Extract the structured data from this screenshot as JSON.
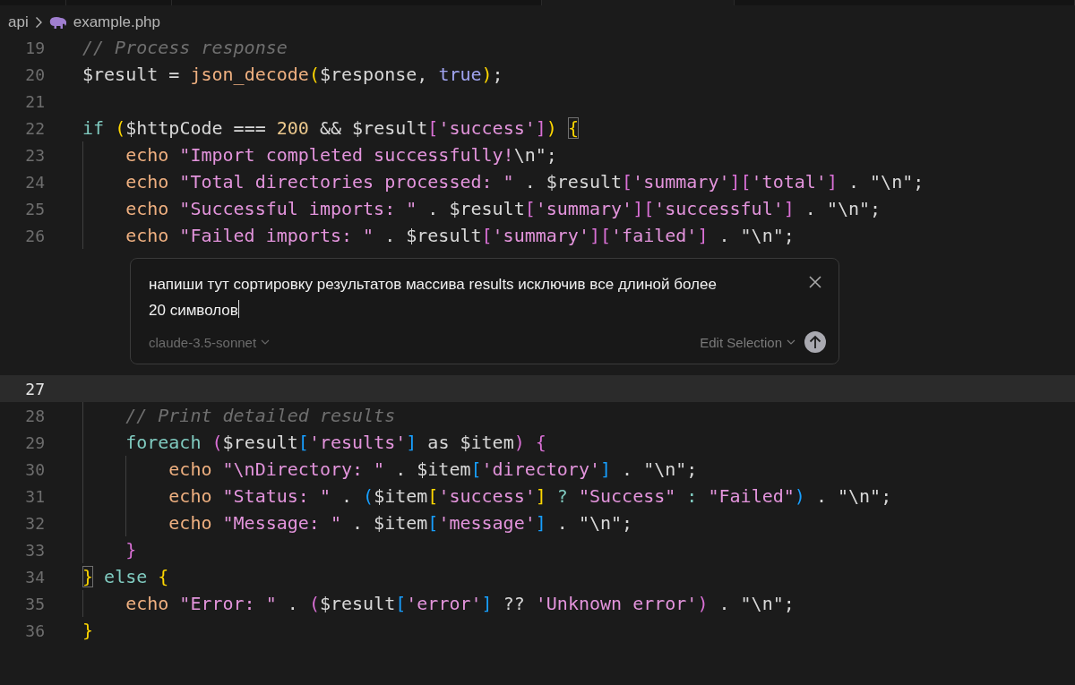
{
  "breadcrumb": {
    "folder": "api",
    "file": "example.php"
  },
  "code_top": [
    {
      "number": "19",
      "current": false,
      "tokens": [
        {
          "kind": "c",
          "text": "// Process response"
        }
      ]
    },
    {
      "number": "20",
      "current": false,
      "tokens": [
        {
          "kind": "t",
          "text": "$result = "
        },
        {
          "kind": "f",
          "text": "json_decode"
        },
        {
          "kind": "g",
          "text": "("
        },
        {
          "kind": "t",
          "text": "$response, "
        },
        {
          "kind": "b",
          "text": "true"
        },
        {
          "kind": "g",
          "text": ")"
        },
        {
          "kind": "t",
          "text": ";"
        }
      ]
    },
    {
      "number": "21",
      "current": false
    },
    {
      "number": "22",
      "current": false,
      "tokens": [
        {
          "kind": "k",
          "text": "if"
        },
        {
          "kind": "g",
          "text": " ("
        },
        {
          "kind": "t",
          "text": "$httpCode === "
        },
        {
          "kind": "n",
          "text": "200"
        },
        {
          "kind": "t",
          "text": " && $result"
        },
        {
          "kind": "p",
          "text": "["
        },
        {
          "kind": "s",
          "text": "'success'"
        },
        {
          "kind": "p",
          "text": "]"
        },
        {
          "kind": "g",
          "text": ") "
        },
        {
          "kind": "gm",
          "text": "{"
        }
      ]
    },
    {
      "number": "23",
      "current": false,
      "tokens": [
        {
          "kind": "f",
          "text": "    echo"
        },
        {
          "kind": "s",
          "text": " \"Import completed successfully!"
        },
        {
          "kind": "t",
          "text": "\\n\";"
        }
      ]
    },
    {
      "number": "24",
      "current": false,
      "tokens": [
        {
          "kind": "f",
          "text": "    echo"
        },
        {
          "kind": "s",
          "text": " \"Total directories processed: \""
        },
        {
          "kind": "t",
          "text": " . $result"
        },
        {
          "kind": "p",
          "text": "["
        },
        {
          "kind": "s",
          "text": "'summary'"
        },
        {
          "kind": "p",
          "text": "]["
        },
        {
          "kind": "s",
          "text": "'total'"
        },
        {
          "kind": "p",
          "text": "]"
        },
        {
          "kind": "t",
          "text": " . \"\\n\";"
        }
      ]
    },
    {
      "number": "25",
      "current": false,
      "tokens": [
        {
          "kind": "f",
          "text": "    echo"
        },
        {
          "kind": "s",
          "text": " \"Successful imports: \""
        },
        {
          "kind": "t",
          "text": " . $result"
        },
        {
          "kind": "p",
          "text": "["
        },
        {
          "kind": "s",
          "text": "'summary'"
        },
        {
          "kind": "p",
          "text": "]["
        },
        {
          "kind": "s",
          "text": "'successful'"
        },
        {
          "kind": "p",
          "text": "]"
        },
        {
          "kind": "t",
          "text": " . \"\\n\";"
        }
      ]
    },
    {
      "number": "26",
      "current": false,
      "tokens": [
        {
          "kind": "f",
          "text": "    echo"
        },
        {
          "kind": "s",
          "text": " \"Failed imports: \""
        },
        {
          "kind": "t",
          "text": " . $result"
        },
        {
          "kind": "p",
          "text": "["
        },
        {
          "kind": "s",
          "text": "'summary'"
        },
        {
          "kind": "p",
          "text": "]["
        },
        {
          "kind": "s",
          "text": "'failed'"
        },
        {
          "kind": "p",
          "text": "]"
        },
        {
          "kind": "t",
          "text": " . \"\\n\";"
        }
      ]
    }
  ],
  "prompt": {
    "value": "напиши тут сортировку результатов массива results исключив все длиной более 20 символов",
    "model": "claude-3.5-sonnet",
    "mode": "Edit Selection"
  },
  "code_bottom": [
    {
      "number": "27",
      "current": true
    },
    {
      "number": "28",
      "current": false,
      "tokens": [
        {
          "kind": "c",
          "text": "    // Print detailed results"
        }
      ]
    },
    {
      "number": "29",
      "current": false,
      "tokens": [
        {
          "kind": "k",
          "text": "    foreach"
        },
        {
          "kind": "p",
          "text": " ("
        },
        {
          "kind": "t",
          "text": "$result"
        },
        {
          "kind": "u",
          "text": "["
        },
        {
          "kind": "s",
          "text": "'results'"
        },
        {
          "kind": "u",
          "text": "]"
        },
        {
          "kind": "t",
          "text": " as $item"
        },
        {
          "kind": "p",
          "text": ")"
        },
        {
          "kind": "p",
          "text": " {"
        }
      ]
    },
    {
      "number": "30",
      "current": false,
      "tokens": [
        {
          "kind": "f",
          "text": "        echo"
        },
        {
          "kind": "s",
          "text": " \"\\nDirectory: \""
        },
        {
          "kind": "t",
          "text": " . $item"
        },
        {
          "kind": "u",
          "text": "["
        },
        {
          "kind": "s",
          "text": "'directory'"
        },
        {
          "kind": "u",
          "text": "]"
        },
        {
          "kind": "t",
          "text": " . \"\\n\";"
        }
      ]
    },
    {
      "number": "31",
      "current": false,
      "tokens": [
        {
          "kind": "f",
          "text": "        echo"
        },
        {
          "kind": "s",
          "text": " \"Status: \""
        },
        {
          "kind": "t",
          "text": " . "
        },
        {
          "kind": "u",
          "text": "("
        },
        {
          "kind": "t",
          "text": "$item"
        },
        {
          "kind": "g",
          "text": "["
        },
        {
          "kind": "s",
          "text": "'success'"
        },
        {
          "kind": "g",
          "text": "]"
        },
        {
          "kind": "k",
          "text": " ?"
        },
        {
          "kind": "s",
          "text": " \"Success\""
        },
        {
          "kind": "k",
          "text": " :"
        },
        {
          "kind": "s",
          "text": " \"Failed\""
        },
        {
          "kind": "u",
          "text": ")"
        },
        {
          "kind": "t",
          "text": " . \"\\n\";"
        }
      ]
    },
    {
      "number": "32",
      "current": false,
      "tokens": [
        {
          "kind": "f",
          "text": "        echo"
        },
        {
          "kind": "s",
          "text": " \"Message: \""
        },
        {
          "kind": "t",
          "text": " . $item"
        },
        {
          "kind": "u",
          "text": "["
        },
        {
          "kind": "s",
          "text": "'message'"
        },
        {
          "kind": "u",
          "text": "]"
        },
        {
          "kind": "t",
          "text": " . \"\\n\";"
        }
      ]
    },
    {
      "number": "33",
      "current": false,
      "tokens": [
        {
          "kind": "p",
          "text": "    }"
        }
      ]
    },
    {
      "number": "34",
      "current": false,
      "tokens": [
        {
          "kind": "gm",
          "text": "}"
        },
        {
          "kind": "k",
          "text": " else"
        },
        {
          "kind": "g",
          "text": " {"
        }
      ]
    },
    {
      "number": "35",
      "current": false,
      "tokens": [
        {
          "kind": "f",
          "text": "    echo"
        },
        {
          "kind": "s",
          "text": " \"Error: \""
        },
        {
          "kind": "t",
          "text": " . "
        },
        {
          "kind": "p",
          "text": "("
        },
        {
          "kind": "t",
          "text": "$result"
        },
        {
          "kind": "u",
          "text": "["
        },
        {
          "kind": "s",
          "text": "'error'"
        },
        {
          "kind": "u",
          "text": "]"
        },
        {
          "kind": "t",
          "text": " ?? "
        },
        {
          "kind": "s",
          "text": "'Unknown error'"
        },
        {
          "kind": "p",
          "text": ")"
        },
        {
          "kind": "t",
          "text": " . \"\\n\";"
        }
      ]
    },
    {
      "number": "36",
      "current": false,
      "tokens": [
        {
          "kind": "g",
          "text": "}"
        }
      ]
    }
  ]
}
